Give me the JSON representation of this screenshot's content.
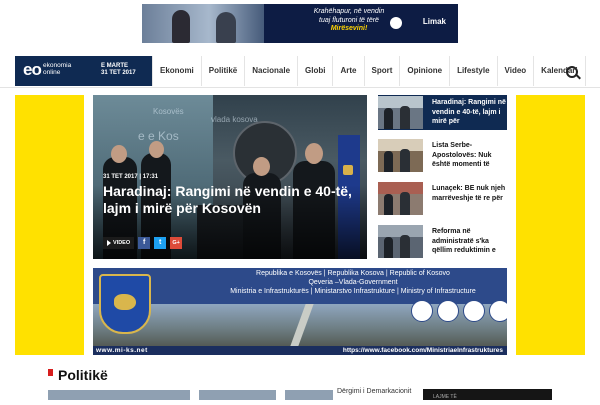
{
  "top_ad": {
    "line1": "Krahëhapur, në vendin",
    "line2": "tuaj fluturoni të tërë",
    "line3": "Mirësevini!",
    "brand": "Limak"
  },
  "brand": {
    "logo": "eo",
    "name_line1": "ekonomia",
    "name_line2": "online",
    "day": "E MARTE",
    "date": "31 TET 2017"
  },
  "nav": {
    "items": [
      "Ekonomi",
      "Politikë",
      "Nacionale",
      "Globi",
      "Arte",
      "Sport",
      "Opinione",
      "Lifestyle",
      "Video",
      "Kalendari"
    ]
  },
  "hero": {
    "wall_text_1": "Kosovës",
    "wall_text_2": "vlada kosova",
    "wall_text_3": "e e Kos",
    "date": "31 TET 2017 | 17:31",
    "title": "Haradinaj: Rangimi në vendin e 40-të, lajm i mirë për Kosovën",
    "video_label": "VIDEO",
    "share_fb": "f",
    "share_tw": "t",
    "share_gp": "G+"
  },
  "list": [
    {
      "text": "Haradinaj: Rangimi në vendin e 40-të, lajm i mirë për"
    },
    {
      "text": "Lista Serbe-Apostolovës: Nuk është momenti të"
    },
    {
      "text": "Lunaçek: BE nuk njeh marrëveshje të re për"
    },
    {
      "text": "Reforma në administratë s'ka qëllim reduktimin e"
    }
  ],
  "ministry": {
    "line1": "Republika e Kosovës | Republika Kosova | Republic of Kosovo",
    "line2": "Qeveria –Vlada-Government",
    "line3": "Ministria e Infrastrukturës | Ministarstvo Infrastrukture | Ministry of Infrastructure",
    "web": "www.mi-ks.net",
    "facebook": "https://www.facebook.com/MinistriaeInfrastruktures"
  },
  "section": {
    "title": "Politikë",
    "caption": "Dërgimi i Demarkacionit",
    "dark_label": "LAJME TË"
  },
  "colors": {
    "navy": "#0f2a52",
    "yellow": "#ffe100",
    "accent_red": "#d71e1e"
  }
}
